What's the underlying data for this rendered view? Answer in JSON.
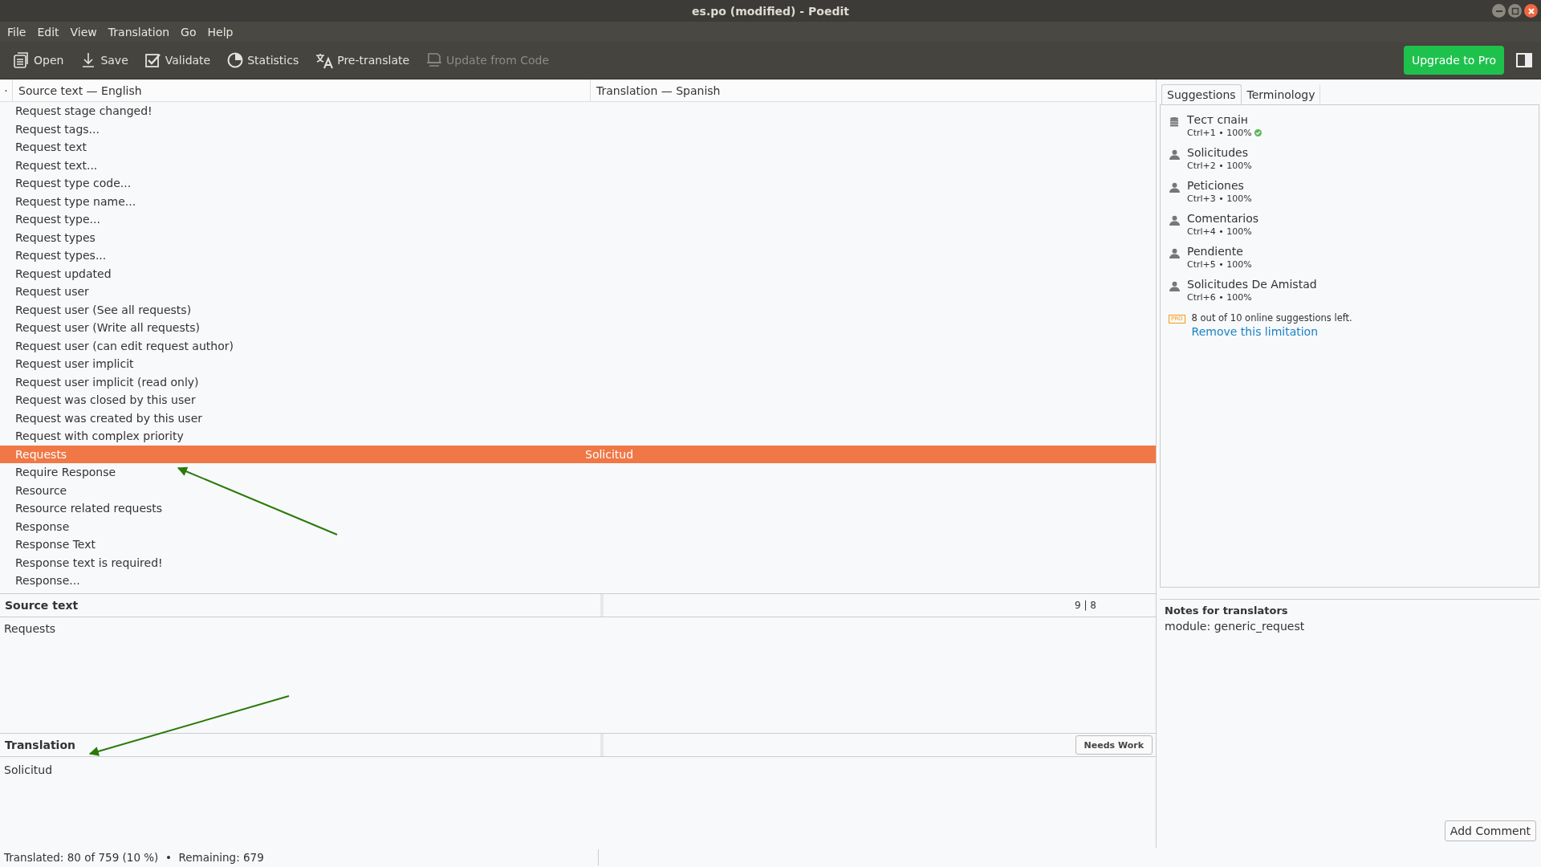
{
  "window": {
    "title": "es.po (modified) - Poedit"
  },
  "menu": [
    "File",
    "Edit",
    "View",
    "Translation",
    "Go",
    "Help"
  ],
  "toolbar": [
    {
      "kind": "open",
      "label": "Open",
      "disabled": false
    },
    {
      "kind": "save",
      "label": "Save",
      "disabled": false
    },
    {
      "kind": "validate",
      "label": "Validate",
      "disabled": false
    },
    {
      "kind": "statistics",
      "label": "Statistics",
      "disabled": false
    },
    {
      "kind": "pretranslate",
      "label": "Pre-translate",
      "disabled": false
    },
    {
      "kind": "update",
      "label": "Update from Code",
      "disabled": true
    }
  ],
  "upgrade_button": "Upgrade to Pro",
  "list": {
    "marker": "·",
    "columns": [
      "Source text — English",
      "Translation — Spanish"
    ],
    "rows": [
      {
        "source": "Request stage changed!",
        "translation": "",
        "selected": false
      },
      {
        "source": "Request tags...",
        "translation": "",
        "selected": false
      },
      {
        "source": "Request text",
        "translation": "",
        "selected": false
      },
      {
        "source": "Request text...",
        "translation": "",
        "selected": false
      },
      {
        "source": "Request type code...",
        "translation": "",
        "selected": false
      },
      {
        "source": "Request type name...",
        "translation": "",
        "selected": false
      },
      {
        "source": "Request type...",
        "translation": "",
        "selected": false
      },
      {
        "source": "Request types",
        "translation": "",
        "selected": false
      },
      {
        "source": "Request types...",
        "translation": "",
        "selected": false
      },
      {
        "source": "Request updated",
        "translation": "",
        "selected": false
      },
      {
        "source": "Request user",
        "translation": "",
        "selected": false
      },
      {
        "source": "Request user (See all requests)",
        "translation": "",
        "selected": false
      },
      {
        "source": "Request user (Write all requests)",
        "translation": "",
        "selected": false
      },
      {
        "source": "Request user (can edit request author)",
        "translation": "",
        "selected": false
      },
      {
        "source": "Request user implicit",
        "translation": "",
        "selected": false
      },
      {
        "source": "Request user implicit (read only)",
        "translation": "",
        "selected": false
      },
      {
        "source": "Request was closed by this user",
        "translation": "",
        "selected": false
      },
      {
        "source": "Request was created by this user",
        "translation": "",
        "selected": false
      },
      {
        "source": "Request with complex priority",
        "translation": "",
        "selected": false
      },
      {
        "source": "Requests",
        "translation": "Solicitud",
        "selected": true
      },
      {
        "source": "Require Response",
        "translation": "",
        "selected": false
      },
      {
        "source": "Resource",
        "translation": "",
        "selected": false
      },
      {
        "source": "Resource related requests",
        "translation": "",
        "selected": false
      },
      {
        "source": "Response",
        "translation": "",
        "selected": false
      },
      {
        "source": "Response Text",
        "translation": "",
        "selected": false
      },
      {
        "source": "Response text is required!",
        "translation": "",
        "selected": false
      },
      {
        "source": "Response...",
        "translation": "",
        "selected": false
      }
    ]
  },
  "sidebar": {
    "tabs": [
      {
        "label": "Suggestions",
        "selected": true
      },
      {
        "label": "Terminology",
        "selected": false
      }
    ],
    "suggestions": [
      {
        "kind": "memory",
        "text": "Тест спаін",
        "shortcut": "Ctrl+1 • 100%",
        "verified": true
      },
      {
        "kind": "person",
        "text": "Solicitudes",
        "shortcut": "Ctrl+2 • 100%",
        "verified": false
      },
      {
        "kind": "person",
        "text": "Peticiones",
        "shortcut": "Ctrl+3 • 100%",
        "verified": false
      },
      {
        "kind": "person",
        "text": "Comentarios",
        "shortcut": "Ctrl+4 • 100%",
        "verified": false
      },
      {
        "kind": "person",
        "text": "Pendiente",
        "shortcut": "Ctrl+5 • 100%",
        "verified": false
      },
      {
        "kind": "person",
        "text": "Solicitudes De Amistad",
        "shortcut": "Ctrl+6 • 100%",
        "verified": false
      }
    ],
    "pro_badge": "PRO",
    "pro_notice": "8 out of 10 online suggestions left.",
    "pro_link": "Remove this limitation",
    "notes_title": "Notes for translators",
    "notes_text": "module: generic_request",
    "add_comment": "Add Comment"
  },
  "editor": {
    "source_header": "Source text",
    "counter": "9 | 8",
    "source_text": "Requests",
    "translation_header": "Translation",
    "status_button": "Needs Work",
    "translation_text": "Solicitud"
  },
  "status_bar": "Translated: 80 of 759 (10 %)  •  Remaining: 679"
}
